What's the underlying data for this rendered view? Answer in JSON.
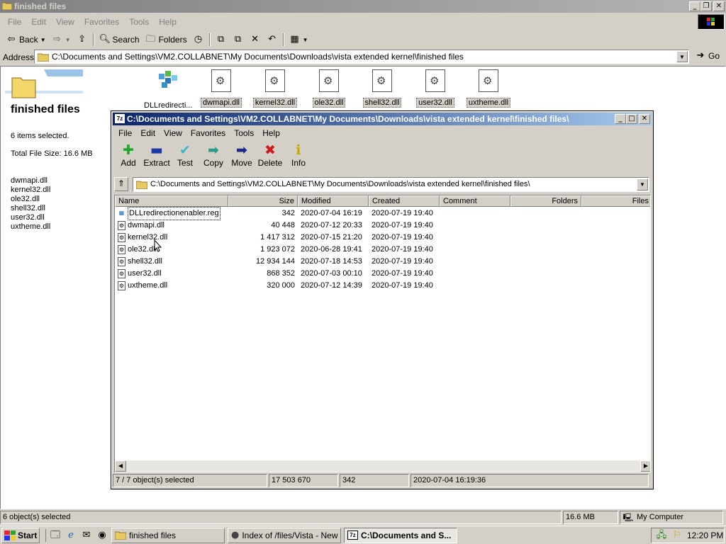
{
  "explorer": {
    "title": "finished files",
    "menu": [
      "File",
      "Edit",
      "View",
      "Favorites",
      "Tools",
      "Help"
    ],
    "toolbar": {
      "back": "Back",
      "search": "Search",
      "folders": "Folders"
    },
    "address": {
      "label": "Address",
      "path": "C:\\Documents and Settings\\VM2.COLLABNET\\My Documents\\Downloads\\vista extended kernel\\finished files",
      "go": "Go"
    },
    "left_pane": {
      "folder_title": "finished files",
      "selected_text": "6 items selected.",
      "total_size": "Total File Size: 16.6 MB",
      "selected_files": [
        "dwmapi.dll",
        "kernel32.dll",
        "ole32.dll",
        "shell32.dll",
        "user32.dll",
        "uxtheme.dll"
      ]
    },
    "icons": [
      {
        "label": "DLLredirecti...",
        "selected": false
      },
      {
        "label": "dwmapi.dll",
        "selected": true
      },
      {
        "label": "kernel32.dll",
        "selected": true
      },
      {
        "label": "ole32.dll",
        "selected": true
      },
      {
        "label": "shell32.dll",
        "selected": true
      },
      {
        "label": "user32.dll",
        "selected": true
      },
      {
        "label": "uxtheme.dll",
        "selected": true
      }
    ],
    "status": {
      "objects": "6 object(s) selected",
      "size": "16.6 MB",
      "zone": "My Computer"
    }
  },
  "zip": {
    "title": "C:\\Documents and Settings\\VM2.COLLABNET\\My Documents\\Downloads\\vista extended kernel\\finished files\\",
    "logo": "7z",
    "menu": [
      "File",
      "Edit",
      "View",
      "Favorites",
      "Tools",
      "Help"
    ],
    "tools": [
      {
        "label": "Add",
        "icon": "plus-icon",
        "color": "#1fa82a"
      },
      {
        "label": "Extract",
        "icon": "minus-icon",
        "color": "#1a3aa8"
      },
      {
        "label": "Test",
        "icon": "check-icon",
        "color": "#3bb8c8"
      },
      {
        "label": "Copy",
        "icon": "arrow-right-icon",
        "color": "#2a9a8a"
      },
      {
        "label": "Move",
        "icon": "arrow-right-icon",
        "color": "#1a2a8a"
      },
      {
        "label": "Delete",
        "icon": "x-icon",
        "color": "#d01818"
      },
      {
        "label": "Info",
        "icon": "info-icon",
        "color": "#c8a800"
      }
    ],
    "path": "C:\\Documents and Settings\\VM2.COLLABNET\\My Documents\\Downloads\\vista extended kernel\\finished files\\",
    "columns": [
      "Name",
      "Size",
      "Modified",
      "Created",
      "Comment",
      "Folders",
      "Files"
    ],
    "rows": [
      {
        "name": "DLLredirectionenabler.reg",
        "size": "342",
        "modified": "2020-07-04 16:19",
        "created": "2020-07-19 19:40",
        "icon": "reg-icon"
      },
      {
        "name": "dwmapi.dll",
        "size": "40 448",
        "modified": "2020-07-12 20:33",
        "created": "2020-07-19 19:40",
        "icon": "dll-icon"
      },
      {
        "name": "kernel32.dll",
        "size": "1 417 312",
        "modified": "2020-07-15 21:20",
        "created": "2020-07-19 19:40",
        "icon": "dll-icon"
      },
      {
        "name": "ole32.dll",
        "size": "1 923 072",
        "modified": "2020-06-28 19:41",
        "created": "2020-07-19 19:40",
        "icon": "dll-icon"
      },
      {
        "name": "shell32.dll",
        "size": "12 934 144",
        "modified": "2020-07-18 14:53",
        "created": "2020-07-19 19:40",
        "icon": "dll-icon"
      },
      {
        "name": "user32.dll",
        "size": "868 352",
        "modified": "2020-07-03 00:10",
        "created": "2020-07-19 19:40",
        "icon": "dll-icon"
      },
      {
        "name": "uxtheme.dll",
        "size": "320 000",
        "modified": "2020-07-12 14:39",
        "created": "2020-07-19 19:40",
        "icon": "dll-icon"
      }
    ],
    "status": {
      "selected": "7 / 7 object(s) selected",
      "total": "17 503 670",
      "focused_size": "342",
      "focused_date": "2020-07-04 16:19:36"
    }
  },
  "taskbar": {
    "start": "Start",
    "tasks": [
      {
        "label": "finished files",
        "active": false
      },
      {
        "label": "Index of /files/Vista - New ...",
        "active": false
      },
      {
        "label": "C:\\Documents and S...",
        "active": true
      }
    ],
    "clock": "12:20 PM"
  }
}
